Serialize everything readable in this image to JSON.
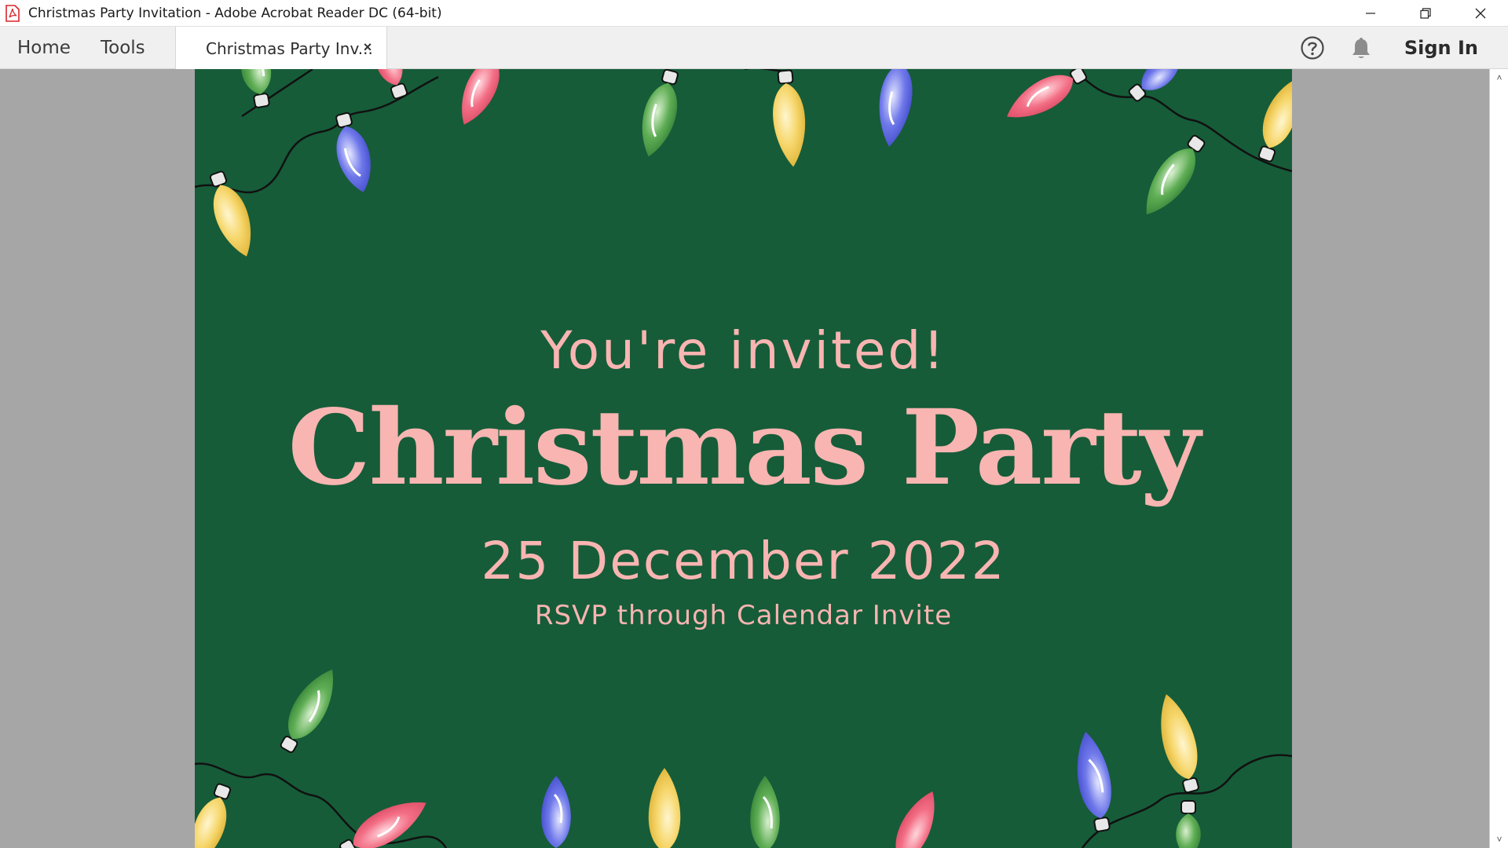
{
  "window": {
    "title": "Christmas Party Invitation - Adobe Acrobat Reader DC (64-bit)",
    "minimize_icon": "minimize-icon",
    "restore_icon": "restore-icon",
    "close_icon": "close-icon"
  },
  "nav": {
    "home": "Home",
    "tools": "Tools"
  },
  "tab": {
    "label": "Christmas Party Inv...",
    "close": "×"
  },
  "toolbar": {
    "help_icon": "help-icon",
    "notifications_icon": "bell-icon",
    "sign_in": "Sign In"
  },
  "document": {
    "invited": "You're invited!",
    "title": "Christmas Party",
    "date": "25 December 2022",
    "rsvp": "RSVP through Calendar Invite",
    "colors": {
      "background": "#165c39",
      "text": "#f8b5b1"
    }
  },
  "scrollbar": {
    "up": "˄",
    "down": "˅"
  }
}
